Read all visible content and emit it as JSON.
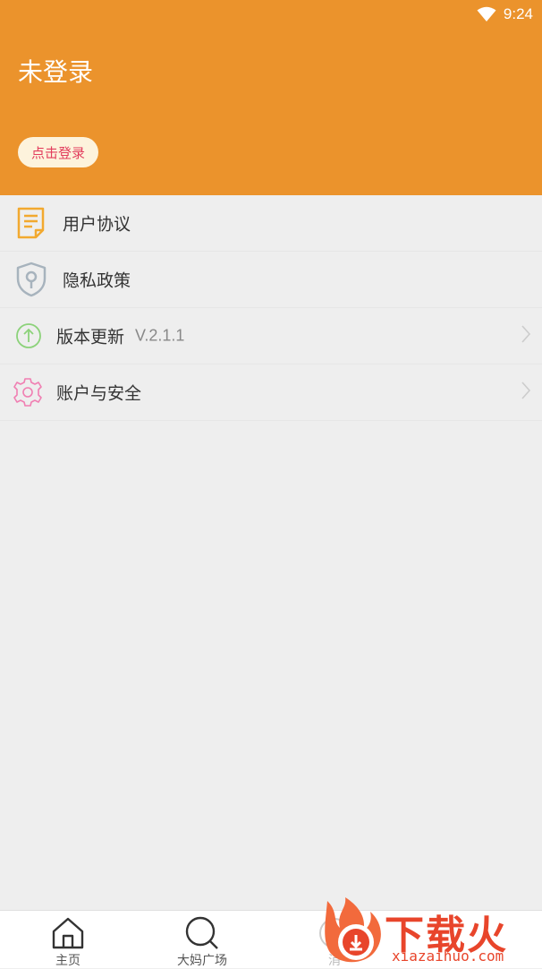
{
  "status_bar": {
    "time": "9:24",
    "wifi_icon": "wifi-icon"
  },
  "header": {
    "user_name": "未登录",
    "login_button": "点击登录"
  },
  "menu": [
    {
      "label": "用户协议",
      "icon": "document-icon"
    },
    {
      "label": "隐私政策",
      "icon": "shield-icon"
    },
    {
      "label": "版本更新",
      "version": "V.2.1.1",
      "icon": "upload-arrow-icon"
    },
    {
      "label": "账户与安全",
      "icon": "gear-icon"
    }
  ],
  "bottom_nav": [
    {
      "label": "主页",
      "icon": "home-icon"
    },
    {
      "label": "大妈广场",
      "icon": "search-icon"
    },
    {
      "label": "消",
      "icon": "message-icon"
    }
  ],
  "watermark": {
    "title": "下载火",
    "domain": "xiazaihuo.com"
  },
  "colors": {
    "header_bg": "#eb932c",
    "page_bg": "#eeeeee",
    "login_btn_bg": "#fdf3dc",
    "login_btn_text": "#e23d5d",
    "watermark": "#e8452b"
  }
}
